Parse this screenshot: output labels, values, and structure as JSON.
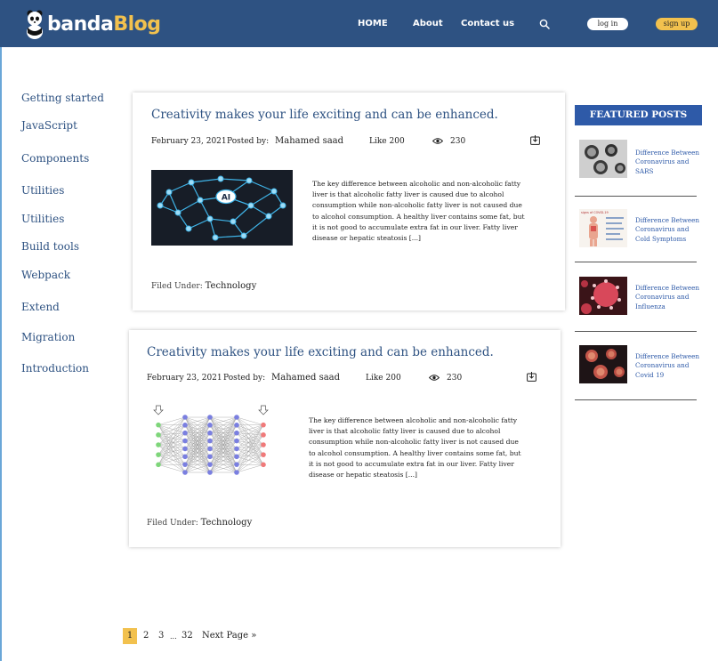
{
  "brand": {
    "name_part1": "banda",
    "name_part2": "Blog",
    "accent_color": "#f2c14e",
    "header_color": "#2e5282"
  },
  "nav": {
    "items": [
      {
        "label": "HOME"
      },
      {
        "label": "About"
      },
      {
        "label": "Contact us"
      }
    ],
    "search_icon": "search-icon",
    "login_label": "log in",
    "signup_label": "sign up"
  },
  "sidebar": {
    "items": [
      {
        "label": "Getting started"
      },
      {
        "label": "JavaScript"
      },
      {
        "label": "Components"
      },
      {
        "label": "Utilities"
      },
      {
        "label": "Utilities"
      },
      {
        "label": "Build tools"
      },
      {
        "label": "Webpack"
      },
      {
        "label": "Extend"
      },
      {
        "label": "Migration"
      },
      {
        "label": "Introduction"
      }
    ]
  },
  "posts": [
    {
      "title": "Creativity makes your life exciting and can be enhanced.",
      "date": "February 23, 2021",
      "posted_by_label": "Posted by:",
      "author": "Mahamed saad",
      "likes": "Like 200",
      "views": "230",
      "excerpt": "The key difference between alcoholic and non-alcoholic fatty liver is that alcoholic fatty liver is caused due to alcohol consumption while non-alcoholic fatty liver is not caused due to alcohol consumption. A healthy liver contains some fat, but it is not good to accumulate extra fat in our liver. Fatty liver disease or hepatic steatosis [...]",
      "filed_label": "Filed Under:",
      "category": "Technology",
      "image_label": "AI"
    },
    {
      "title": "Creativity makes your life exciting and can be enhanced.",
      "date": "February 23, 2021",
      "posted_by_label": "Posted by:",
      "author": "Mahamed saad",
      "likes": "Like 200",
      "views": "230",
      "excerpt": "The key difference between alcoholic and non-alcoholic fatty liver is that alcoholic fatty liver is caused due to alcohol consumption while non-alcoholic fatty liver is not caused due to alcohol consumption. A healthy liver contains some fat, but it is not good to accumulate extra fat in our liver. Fatty liver disease or hepatic steatosis [...]",
      "filed_label": "Filed Under:",
      "category": "Technology"
    }
  ],
  "featured": {
    "heading": "FEATURED POSTS",
    "items": [
      {
        "title": "Difference Between Coronavirus and SARS"
      },
      {
        "title": "Difference Between Coronavirus and Cold Symptoms",
        "thumb_label": "signs of COVID-19"
      },
      {
        "title": "Difference Between Coronavirus and Influenza"
      },
      {
        "title": "Difference Between Coronavirus and Covid 19"
      }
    ]
  },
  "pagination": {
    "current": "1",
    "pages": [
      "2",
      "3"
    ],
    "ellipsis": "...",
    "last": "32",
    "next_label": "Next Page »"
  }
}
